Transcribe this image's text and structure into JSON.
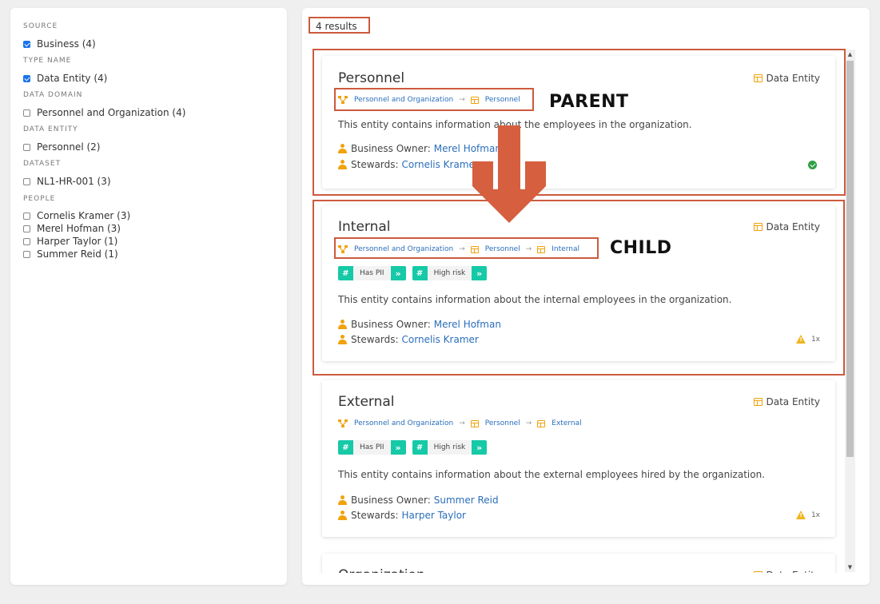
{
  "filters": {
    "sections": [
      {
        "title": "SOURCE",
        "options": [
          {
            "label": "Business (4)",
            "checked": true
          }
        ]
      },
      {
        "title": "TYPE NAME",
        "options": [
          {
            "label": "Data Entity (4)",
            "checked": true
          }
        ]
      },
      {
        "title": "DATA DOMAIN",
        "options": [
          {
            "label": "Personnel and Organization (4)",
            "checked": false
          }
        ]
      },
      {
        "title": "DATA ENTITY",
        "options": [
          {
            "label": "Personnel (2)",
            "checked": false
          }
        ]
      },
      {
        "title": "DATASET",
        "options": [
          {
            "label": "NL1-HR-001 (3)",
            "checked": false
          }
        ]
      },
      {
        "title": "PEOPLE",
        "options": [
          {
            "label": "Cornelis Kramer (3)",
            "checked": false
          },
          {
            "label": "Merel Hofman (3)",
            "checked": false
          },
          {
            "label": "Harper Taylor (1)",
            "checked": false
          },
          {
            "label": "Summer Reid (1)",
            "checked": false
          }
        ]
      }
    ]
  },
  "results": {
    "count_label": "4 results",
    "cards": [
      {
        "title": "Personnel",
        "type": "Data Entity",
        "breadcrumb": [
          "Personnel and Organization",
          "Personnel"
        ],
        "tags": [],
        "description": "This entity contains information about the employees in the organization.",
        "owner_label": "Business Owner:",
        "owner": "Merel Hofman",
        "stewards_label": "Stewards:",
        "stewards": "Cornelis Kramer",
        "status": "ok"
      },
      {
        "title": "Internal",
        "type": "Data Entity",
        "breadcrumb": [
          "Personnel and Organization",
          "Personnel",
          "Internal"
        ],
        "tags": [
          "Has PII",
          "High risk"
        ],
        "description": "This entity contains information about the internal employees in the organization.",
        "owner_label": "Business Owner:",
        "owner": "Merel Hofman",
        "stewards_label": "Stewards:",
        "stewards": "Cornelis Kramer",
        "warning_count": "1x"
      },
      {
        "title": "External",
        "type": "Data Entity",
        "breadcrumb": [
          "Personnel and Organization",
          "Personnel",
          "External"
        ],
        "tags": [
          "Has PII",
          "High risk"
        ],
        "description": "This entity contains information about the external employees hired by the organization.",
        "owner_label": "Business Owner:",
        "owner": "Summer Reid",
        "stewards_label": "Stewards:",
        "stewards": "Harper Taylor",
        "warning_count": "1x"
      },
      {
        "title": "Organization",
        "type": "Data Entity"
      }
    ]
  },
  "annotations": {
    "parent_label": "PARENT",
    "child_label": "CHILD",
    "color": "#cc5a3e"
  }
}
